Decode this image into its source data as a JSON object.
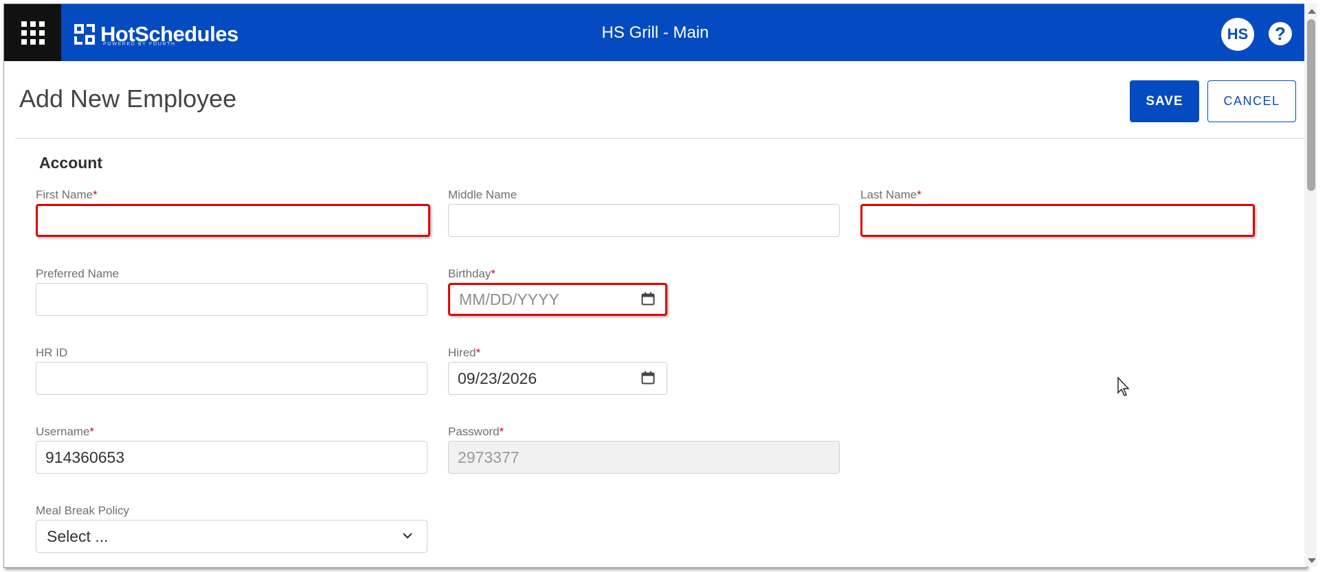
{
  "header": {
    "brand": "HotSchedules",
    "brand_sub": "POWERED BY FOURTH",
    "store": "HS Grill - Main",
    "avatar_initials": "HS",
    "help_symbol": "?",
    "accent_color": "#044bc1"
  },
  "page": {
    "title": "Add New Employee",
    "save_label": "SAVE",
    "cancel_label": "CANCEL"
  },
  "section": {
    "title": "Account"
  },
  "fields": {
    "first_name": {
      "label": "First Name",
      "required": "*",
      "value": ""
    },
    "middle_name": {
      "label": "Middle Name",
      "value": ""
    },
    "last_name": {
      "label": "Last Name",
      "required": "*",
      "value": ""
    },
    "preferred_name": {
      "label": "Preferred Name",
      "value": ""
    },
    "birthday": {
      "label": "Birthday",
      "required": "*",
      "value": "",
      "placeholder": "MM/DD/YYYY"
    },
    "hr_id": {
      "label": "HR ID",
      "value": ""
    },
    "hired": {
      "label": "Hired",
      "required": "*",
      "value": "09/23/2026"
    },
    "username": {
      "label": "Username",
      "required": "*",
      "value": "914360653"
    },
    "password": {
      "label": "Password",
      "required": "*",
      "value": "2973377"
    },
    "meal_break_policy": {
      "label": "Meal Break Policy",
      "selected": "Select ..."
    }
  },
  "icons": {
    "apps": "apps-grid-icon",
    "calendar": "calendar-icon",
    "chevron": "chevron-down-icon"
  }
}
